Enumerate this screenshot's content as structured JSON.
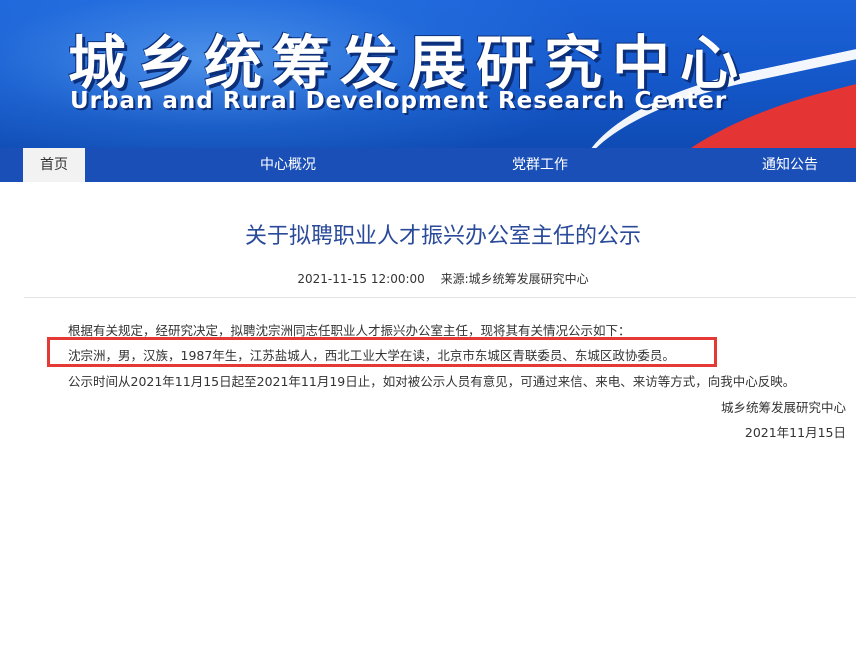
{
  "header": {
    "title_cn": "城乡统筹发展研究中心",
    "title_en": "Urban and Rural Development Research Center"
  },
  "nav": {
    "items": [
      {
        "label": "首页"
      },
      {
        "label": "中心概况"
      },
      {
        "label": "党群工作"
      },
      {
        "label": "通知公告"
      }
    ],
    "active_index": 0
  },
  "article": {
    "title": "关于拟聘职业人才振兴办公室主任的公示",
    "date": "2021-11-15 12:00:00",
    "source": "来源:城乡统筹发展研究中心",
    "paragraphs": [
      "根据有关规定，经研究决定，拟聘沈宗洲同志任职业人才振兴办公室主任，现将其有关情况公示如下：",
      "沈宗洲，男，汉族，1987年生，江苏盐城人，西北工业大学在读，北京市东城区青联委员、东城区政协委员。",
      "公示时间从2021年11月15日起至2021年11月19日止，如对被公示人员有意见，可通过来信、来电、来访等方式，向我中心反映。"
    ],
    "signature": "城乡统筹发展研究中心",
    "sign_date": "2021年11月15日"
  },
  "colors": {
    "banner_blue": "#1457c9",
    "nav_blue": "#1a4fb8",
    "title_blue": "#2a4a9a",
    "highlight_red": "#e53935"
  }
}
